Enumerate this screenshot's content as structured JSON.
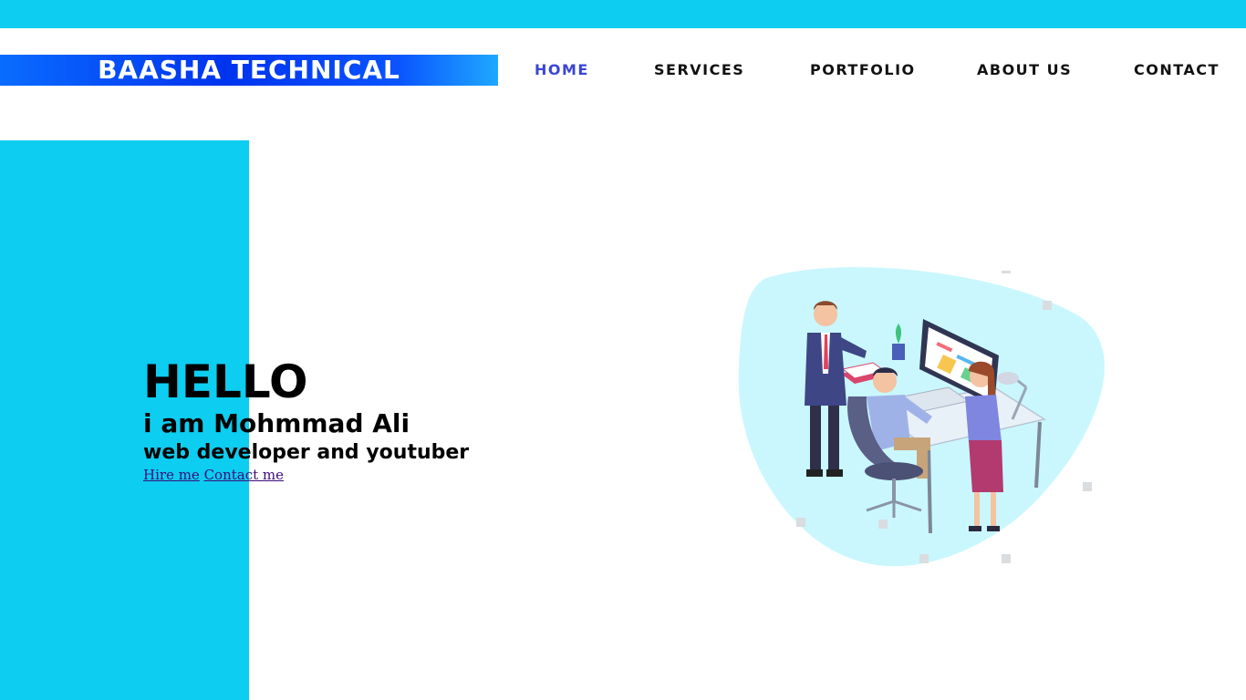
{
  "header": {
    "logo_text": "BAASHA TECHNICAL",
    "nav": [
      {
        "label": "HOME",
        "active": true
      },
      {
        "label": "SERVICES",
        "active": false
      },
      {
        "label": "PORTFOLIO",
        "active": false
      },
      {
        "label": "ABOUT US",
        "active": false
      },
      {
        "label": "CONTACT",
        "active": false
      }
    ]
  },
  "hero": {
    "greeting": "HELLO",
    "intro": "i am Mohmmad Ali",
    "role": "web developer and youtuber",
    "hire_link": "Hire me",
    "contact_link": "Contact me"
  },
  "colors": {
    "accent_cyan": "#0dcdf0",
    "logo_blue": "#0033ee",
    "nav_active": "#3b46d4",
    "blob": "#c9f7fd"
  },
  "illustration": {
    "icon": "office-team-illustration"
  }
}
